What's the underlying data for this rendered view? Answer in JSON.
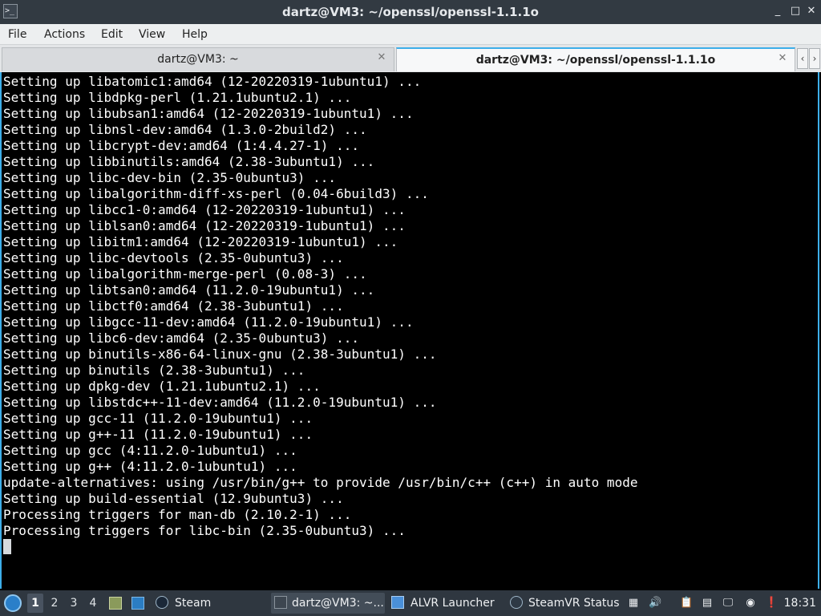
{
  "window": {
    "title": "dartz@VM3: ~/openssl/openssl-1.1.1o",
    "app_icon": ">_",
    "controls": {
      "minimize": "_",
      "maximize": "□",
      "close": "✕"
    }
  },
  "menu": {
    "items": [
      "File",
      "Actions",
      "Edit",
      "View",
      "Help"
    ]
  },
  "tabs": [
    {
      "label": "dartz@VM3: ~",
      "active": false
    },
    {
      "label": "dartz@VM3: ~/openssl/openssl-1.1.1o",
      "active": true
    }
  ],
  "tab_nav": {
    "left": "‹",
    "right": "›"
  },
  "terminal": {
    "lines": [
      "Setting up libatomic1:amd64 (12-20220319-1ubuntu1) ...",
      "Setting up libdpkg-perl (1.21.1ubuntu2.1) ...",
      "Setting up libubsan1:amd64 (12-20220319-1ubuntu1) ...",
      "Setting up libnsl-dev:amd64 (1.3.0-2build2) ...",
      "Setting up libcrypt-dev:amd64 (1:4.4.27-1) ...",
      "Setting up libbinutils:amd64 (2.38-3ubuntu1) ...",
      "Setting up libc-dev-bin (2.35-0ubuntu3) ...",
      "Setting up libalgorithm-diff-xs-perl (0.04-6build3) ...",
      "Setting up libcc1-0:amd64 (12-20220319-1ubuntu1) ...",
      "Setting up liblsan0:amd64 (12-20220319-1ubuntu1) ...",
      "Setting up libitm1:amd64 (12-20220319-1ubuntu1) ...",
      "Setting up libc-devtools (2.35-0ubuntu3) ...",
      "Setting up libalgorithm-merge-perl (0.08-3) ...",
      "Setting up libtsan0:amd64 (11.2.0-19ubuntu1) ...",
      "Setting up libctf0:amd64 (2.38-3ubuntu1) ...",
      "Setting up libgcc-11-dev:amd64 (11.2.0-19ubuntu1) ...",
      "Setting up libc6-dev:amd64 (2.35-0ubuntu3) ...",
      "Setting up binutils-x86-64-linux-gnu (2.38-3ubuntu1) ...",
      "Setting up binutils (2.38-3ubuntu1) ...",
      "Setting up dpkg-dev (1.21.1ubuntu2.1) ...",
      "Setting up libstdc++-11-dev:amd64 (11.2.0-19ubuntu1) ...",
      "Setting up gcc-11 (11.2.0-19ubuntu1) ...",
      "Setting up g++-11 (11.2.0-19ubuntu1) ...",
      "Setting up gcc (4:11.2.0-1ubuntu1) ...",
      "Setting up g++ (4:11.2.0-1ubuntu1) ...",
      "update-alternatives: using /usr/bin/g++ to provide /usr/bin/c++ (c++) in auto mode",
      "Setting up build-essential (12.9ubuntu3) ...",
      "Processing triggers for man-db (2.10.2-1) ...",
      "Processing triggers for libc-bin (2.35-0ubuntu3) ..."
    ]
  },
  "taskbar": {
    "workspaces": [
      "1",
      "2",
      "3",
      "4"
    ],
    "active_workspace": "1",
    "tasks": [
      {
        "label": "Steam",
        "icon": "steam-icon"
      },
      {
        "label": "dartz@VM3: ~...",
        "icon": "terminal-icon",
        "active": true
      },
      {
        "label": "ALVR Launcher",
        "icon": "window-icon"
      },
      {
        "label": "SteamVR Status",
        "icon": "steamvr-icon"
      }
    ],
    "clock": "18:31"
  },
  "colors": {
    "accent": "#3daee9",
    "titlebar": "#323a42",
    "taskbar": "#2f3740",
    "terminal_bg": "#000000",
    "terminal_fg": "#ffffff"
  }
}
